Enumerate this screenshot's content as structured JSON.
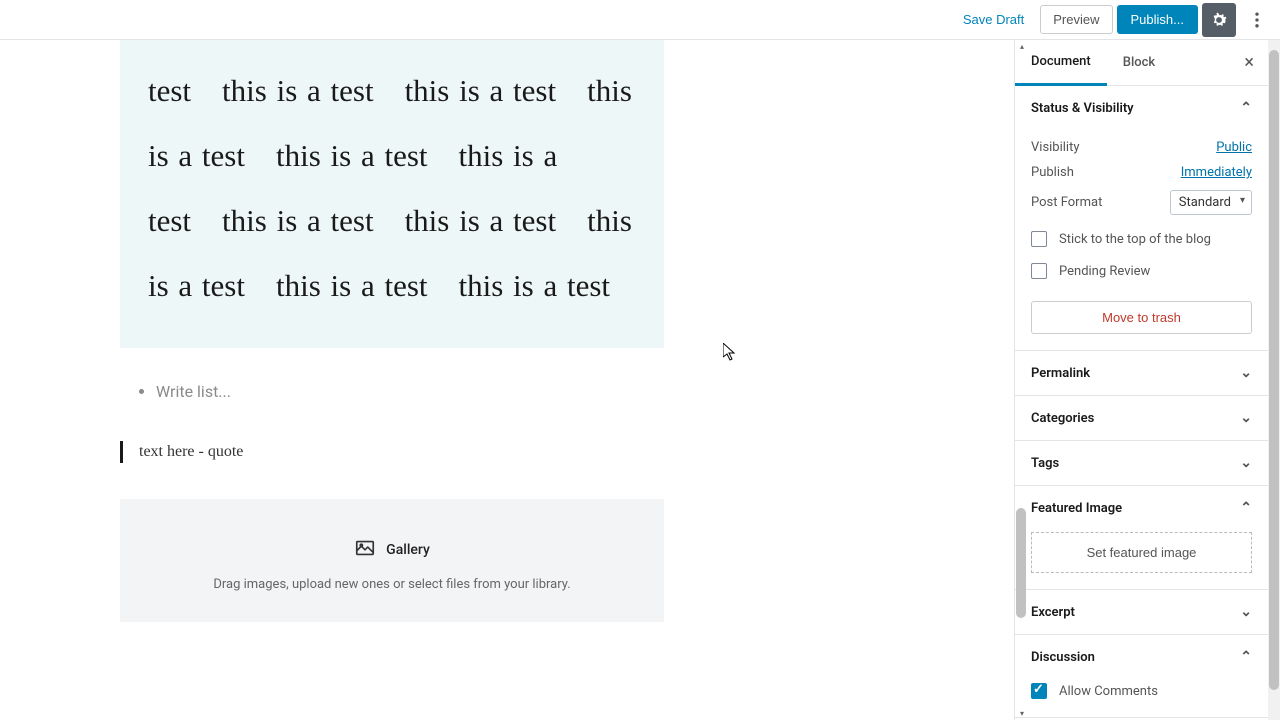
{
  "topbar": {
    "save": "Save Draft",
    "preview": "Preview",
    "publish": "Publish..."
  },
  "editor": {
    "paragraph": "test this is a test this is a test this is a test this is a test this is a test this is a test this is a test this is a test this is a test this is a test",
    "list_placeholder": "Write list...",
    "quote": "text here - quote",
    "gallery": {
      "title": "Gallery",
      "subtitle": "Drag images, upload new ones or select files from your library."
    }
  },
  "sidebar": {
    "tabs": {
      "document": "Document",
      "block": "Block"
    },
    "status": {
      "title": "Status & Visibility",
      "visibility_label": "Visibility",
      "visibility_value": "Public",
      "publish_label": "Publish",
      "publish_value": "Immediately",
      "format_label": "Post Format",
      "format_value": "Standard",
      "stick": "Stick to the top of the blog",
      "pending": "Pending Review",
      "trash": "Move to trash"
    },
    "permalink": "Permalink",
    "categories": "Categories",
    "tags": "Tags",
    "featured": {
      "title": "Featured Image",
      "button": "Set featured image"
    },
    "excerpt": "Excerpt",
    "discussion": {
      "title": "Discussion",
      "allow": "Allow Comments"
    }
  }
}
